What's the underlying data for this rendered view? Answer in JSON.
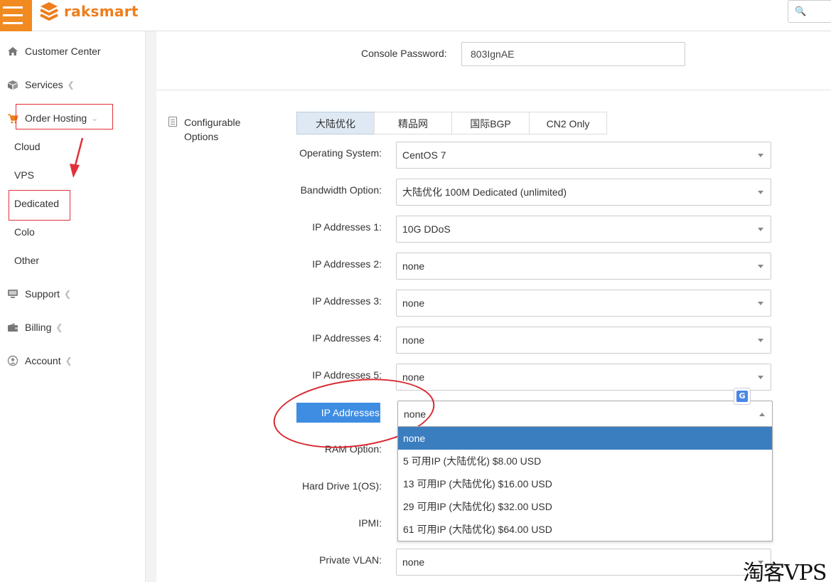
{
  "brand": {
    "name": "raksmart",
    "color": "#ee7d1b",
    "accent": "#f18a21"
  },
  "header": {
    "search_icon": "search-icon"
  },
  "sidebar": {
    "items": [
      {
        "label": "Customer Center",
        "icon": "home-icon"
      },
      {
        "label": "Services",
        "icon": "box-icon"
      },
      {
        "label": "Order Hosting",
        "icon": "cart-icon"
      },
      {
        "label": "Support",
        "icon": "monitor-icon"
      },
      {
        "label": "Billing",
        "icon": "wallet-icon"
      },
      {
        "label": "Account",
        "icon": "user-icon"
      }
    ],
    "subitems": [
      "Cloud",
      "VPS",
      "Dedicated",
      "Colo",
      "Other"
    ]
  },
  "console": {
    "label": "Console Password:",
    "value": "803IgnAE"
  },
  "configurable": {
    "label": "Configurable Options"
  },
  "tabs": [
    {
      "label": "大陆优化",
      "active": true
    },
    {
      "label": "精品网",
      "active": false
    },
    {
      "label": "国际BGP",
      "active": false
    },
    {
      "label": "CN2 Only",
      "active": false
    }
  ],
  "fields": [
    {
      "label": "Operating System:",
      "value": "CentOS 7"
    },
    {
      "label": "Bandwidth Option:",
      "value": "大陆优化 100M Dedicated (unlimited)"
    },
    {
      "label": "IP Addresses 1:",
      "value": "10G DDoS"
    },
    {
      "label": "IP Addresses 2:",
      "value": "none"
    },
    {
      "label": "IP Addresses 3:",
      "value": "none"
    },
    {
      "label": "IP Addresses 4:",
      "value": "none"
    },
    {
      "label": "IP Addresses 5:",
      "value": "none"
    }
  ],
  "ip_more": {
    "label": "IP Addresses More:",
    "value": "none",
    "options": [
      "none",
      "5 可用IP (大陆优化) $8.00 USD",
      "13 可用IP (大陆优化) $16.00 USD",
      "29 可用IP (大陆优化) $32.00 USD",
      "61 可用IP (大陆优化) $64.00 USD"
    ],
    "selected_index": 0
  },
  "hidden_fields": [
    {
      "label": "RAM Option:"
    },
    {
      "label": "Hard Drive 1(OS):"
    },
    {
      "label": "IPMI:"
    }
  ],
  "private_vlan": {
    "label": "Private VLAN:",
    "value": "none"
  },
  "watermark": "淘客VPS"
}
